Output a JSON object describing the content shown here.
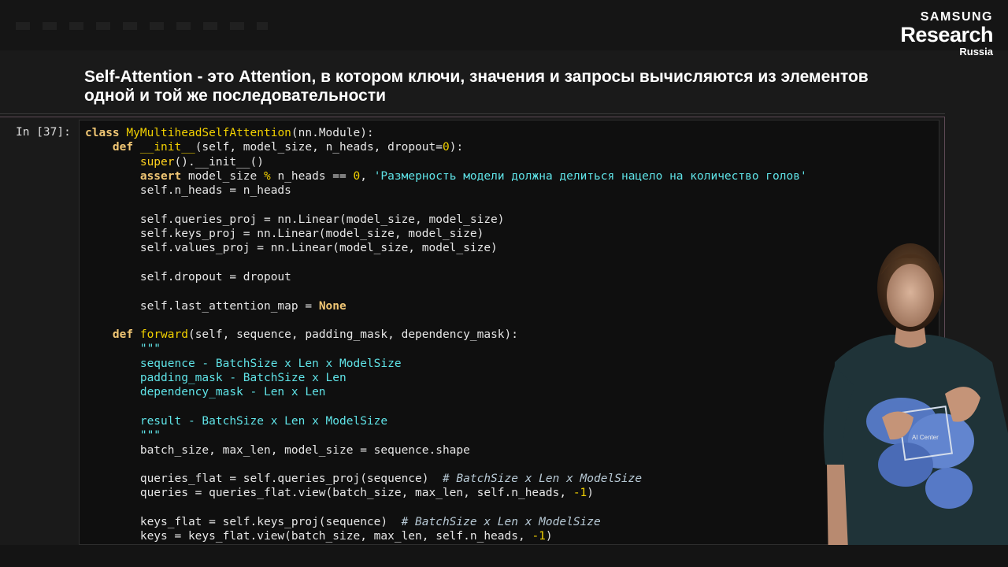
{
  "logo": {
    "line1": "SAMSUNG",
    "line2": "Research",
    "line3": "Russia"
  },
  "slide": {
    "heading": "Self-Attention - это Attention, в котором ключи, значения и запросы вычисляются из элементов одной и той же последовательности"
  },
  "notebook": {
    "prompt": "In [37]:",
    "lines": [
      "class MyMultiheadSelfAttention(nn.Module):",
      "    def __init__(self, model_size, n_heads, dropout=0):",
      "        super().__init__()",
      "        assert model_size % n_heads == 0, 'Размерность модели должна делиться нацело на количество голов'",
      "        self.n_heads = n_heads",
      "",
      "        self.queries_proj = nn.Linear(model_size, model_size)",
      "        self.keys_proj = nn.Linear(model_size, model_size)",
      "        self.values_proj = nn.Linear(model_size, model_size)",
      "",
      "        self.dropout = dropout",
      "",
      "        self.last_attention_map = None",
      "",
      "    def forward(self, sequence, padding_mask, dependency_mask):",
      "        \"\"\"",
      "        sequence - BatchSize x Len x ModelSize",
      "        padding_mask - BatchSize x Len",
      "        dependency_mask - Len x Len",
      "",
      "        result - BatchSize x Len x ModelSize",
      "        \"\"\"",
      "        batch_size, max_len, model_size = sequence.shape",
      "",
      "        queries_flat = self.queries_proj(sequence)  # BatchSize x Len x ModelSize",
      "        queries = queries_flat.view(batch_size, max_len, self.n_heads, -1)",
      "",
      "        keys_flat = self.keys_proj(sequence)  # BatchSize x Len x ModelSize",
      "        keys = keys_flat.view(batch_size, max_len, self.n_heads, -1)"
    ]
  },
  "presenter": {
    "shirt_logo_text": "AI Center"
  },
  "colors": {
    "background": "#1a1a1a",
    "code_background": "#0f0f0f",
    "keyword": "#f0c674",
    "string": "#5fe3e7",
    "comment": "#b8cad6",
    "cell_border": "#5e4a55"
  }
}
